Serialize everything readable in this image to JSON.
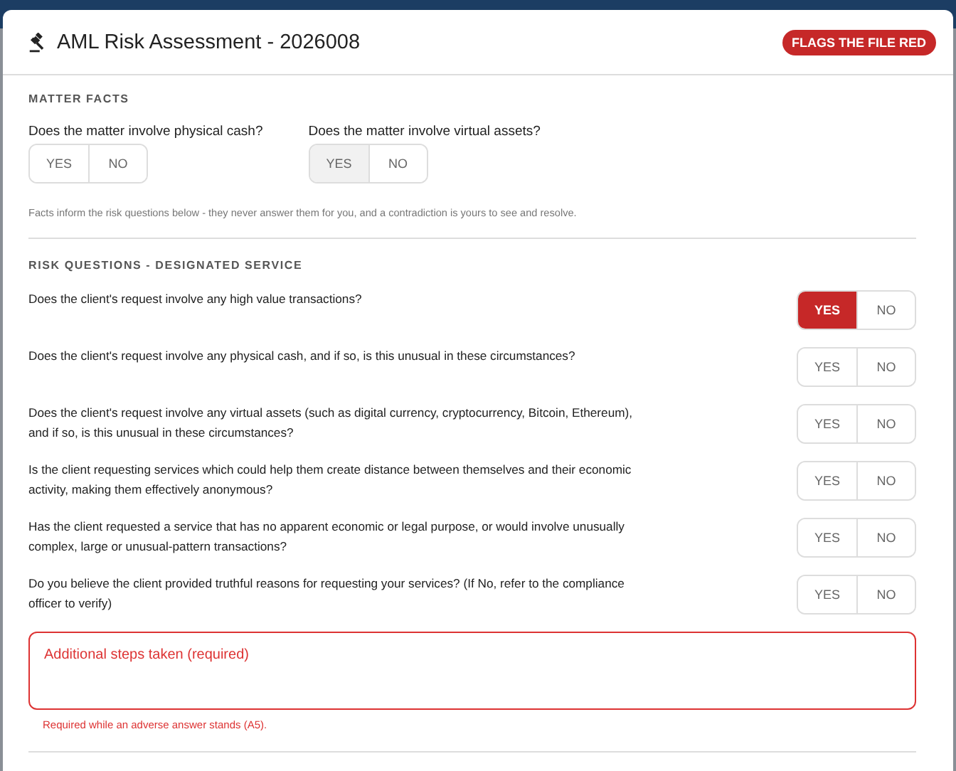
{
  "dialog": {
    "title": "AML Risk Assessment - 2026008",
    "badge": "FLAGS THE FILE RED"
  },
  "matter_facts": {
    "heading": "MATTER FACTS",
    "questions": [
      {
        "label": "Does the matter involve physical cash?",
        "options": [
          {
            "label": "YES",
            "selected": false
          },
          {
            "label": "NO",
            "selected": false
          }
        ]
      },
      {
        "label": "Does the matter involve virtual assets?",
        "options": [
          {
            "label": "YES",
            "selected": true
          },
          {
            "label": "NO",
            "selected": false
          }
        ]
      }
    ],
    "hint": "Facts inform the risk questions below - they never answer them for you, and a contradiction is yours to see and resolve."
  },
  "risk_questions": {
    "heading": "RISK QUESTIONS - DESIGNATED SERVICE",
    "questions": [
      {
        "label": "Does the client's request involve any high value transactions?",
        "options": [
          {
            "label": "YES",
            "selected": true
          },
          {
            "label": "NO",
            "selected": false
          }
        ]
      },
      {
        "label": "Does the client's request involve any physical cash, and if so, is this unusual in these circumstances?",
        "options": [
          {
            "label": "YES",
            "selected": false
          },
          {
            "label": "NO",
            "selected": false
          }
        ]
      },
      {
        "label": "Does the client's request involve any virtual assets (such as digital currency, cryptocurrency, Bitcoin, Ethereum), and if so, is this unusual in these circumstances?",
        "options": [
          {
            "label": "YES",
            "selected": false
          },
          {
            "label": "NO",
            "selected": false
          }
        ]
      },
      {
        "label": "Is the client requesting services which could help them create distance between themselves and their economic activity, making them effectively anonymous?",
        "options": [
          {
            "label": "YES",
            "selected": false
          },
          {
            "label": "NO",
            "selected": false
          }
        ]
      },
      {
        "label": "Has the client requested a service that has no apparent economic or legal purpose, or would involve unusually complex, large or unusual-pattern transactions?",
        "options": [
          {
            "label": "YES",
            "selected": false
          },
          {
            "label": "NO",
            "selected": false
          }
        ]
      },
      {
        "label": "Do you believe the client provided truthful reasons for requesting your services? (If No, refer to the compliance officer to verify)",
        "options": [
          {
            "label": "YES",
            "selected": false
          },
          {
            "label": "NO",
            "selected": false
          }
        ]
      }
    ]
  },
  "steps_field": {
    "placeholder": "Additional steps taken (required)",
    "invalid": true,
    "error": "Required while an adverse answer stands (A5)."
  }
}
